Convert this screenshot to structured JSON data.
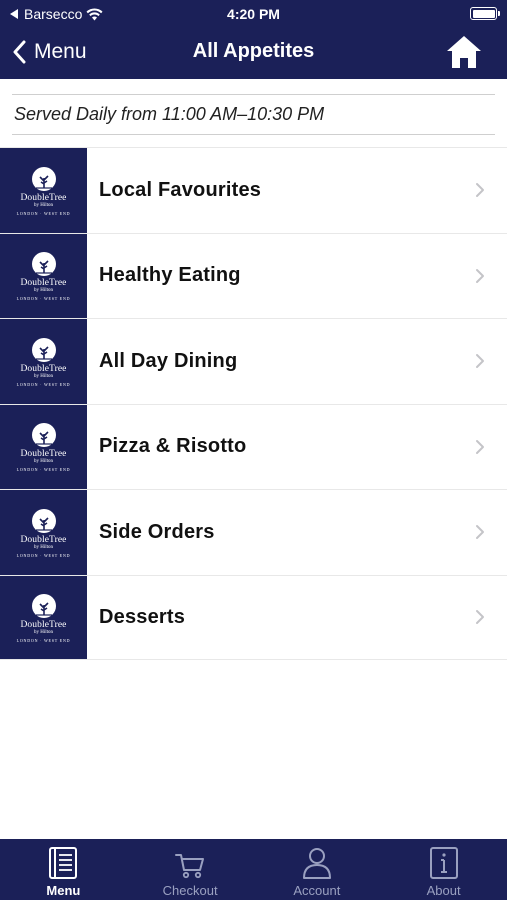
{
  "status_bar": {
    "carrier": "Barsecco",
    "time": "4:20 PM"
  },
  "nav": {
    "back_label": "Menu",
    "title": "All Appetites",
    "home_icon": "home-icon"
  },
  "served_text": "Served Daily from 11:00 AM–10:30 PM",
  "thumbnail": {
    "brand": "DoubleTree",
    "sub": "by Hilton",
    "location": "LONDON · WEST END"
  },
  "menu_items": [
    {
      "label": "Local Favourites"
    },
    {
      "label": "Healthy Eating"
    },
    {
      "label": "All Day Dining"
    },
    {
      "label": "Pizza & Risotto"
    },
    {
      "label": "Side Orders"
    },
    {
      "label": "Desserts"
    }
  ],
  "tabs": [
    {
      "label": "Menu",
      "icon": "menu-book-icon",
      "active": true
    },
    {
      "label": "Checkout",
      "icon": "cart-icon",
      "active": false
    },
    {
      "label": "Account",
      "icon": "user-icon",
      "active": false
    },
    {
      "label": "About",
      "icon": "info-icon",
      "active": false
    }
  ],
  "colors": {
    "brand_navy": "#1b2058",
    "tab_inactive": "#9aa0c0",
    "chevron": "#c4c4c8"
  }
}
